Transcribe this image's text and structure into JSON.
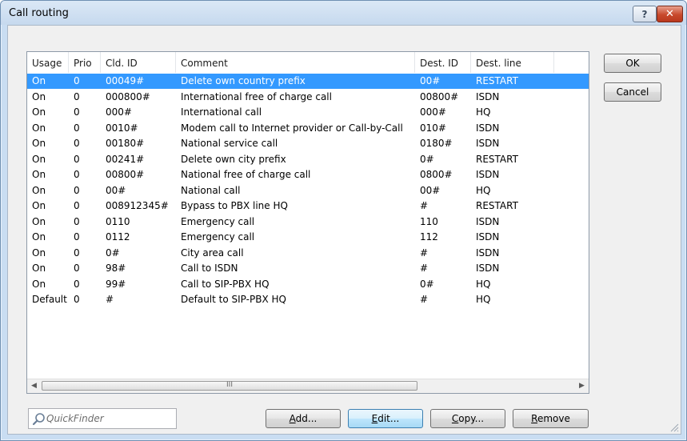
{
  "window": {
    "title": "Call routing"
  },
  "title_buttons": {
    "help": "?",
    "close": "✕"
  },
  "table": {
    "columns": [
      "Usage",
      "Prio",
      "Cld. ID",
      "Comment",
      "Dest. ID",
      "Dest. line"
    ],
    "rows": [
      [
        "On",
        "0",
        "00049#",
        "Delete own country prefix",
        "00#",
        "RESTART"
      ],
      [
        "On",
        "0",
        "000800#",
        "International free of charge call",
        "00800#",
        "ISDN"
      ],
      [
        "On",
        "0",
        "000#",
        "International call",
        "000#",
        "HQ"
      ],
      [
        "On",
        "0",
        "0010#",
        "Modem call to Internet provider or Call-by-Call",
        "010#",
        "ISDN"
      ],
      [
        "On",
        "0",
        "00180#",
        "National service call",
        "0180#",
        "ISDN"
      ],
      [
        "On",
        "0",
        "00241#",
        "Delete own city prefix",
        "0#",
        "RESTART"
      ],
      [
        "On",
        "0",
        "00800#",
        "National free of charge call",
        "0800#",
        "ISDN"
      ],
      [
        "On",
        "0",
        "00#",
        "National call",
        "00#",
        "HQ"
      ],
      [
        "On",
        "0",
        "008912345#",
        "Bypass to PBX line HQ",
        "#",
        "RESTART"
      ],
      [
        "On",
        "0",
        "0110",
        "Emergency call",
        "110",
        "ISDN"
      ],
      [
        "On",
        "0",
        "0112",
        "Emergency call",
        "112",
        "ISDN"
      ],
      [
        "On",
        "0",
        "0#",
        "City area call",
        "#",
        "ISDN"
      ],
      [
        "On",
        "0",
        "98#",
        "Call to ISDN",
        "#",
        "ISDN"
      ],
      [
        "On",
        "0",
        "99#",
        "Call to SIP-PBX HQ",
        "0#",
        "HQ"
      ],
      [
        "Default",
        "0",
        "#",
        "Default to SIP-PBX HQ",
        "#",
        "HQ"
      ]
    ],
    "selected_row": 0,
    "scroll_thumb_glyph": "III"
  },
  "buttons": {
    "ok": "OK",
    "cancel": "Cancel",
    "add": {
      "mnemonic": "A",
      "rest": "dd..."
    },
    "edit": {
      "mnemonic": "E",
      "rest": "dit..."
    },
    "copy": {
      "mnemonic": "C",
      "rest": "opy..."
    },
    "remove": {
      "mnemonic": "R",
      "rest": "emove"
    }
  },
  "quickfinder": {
    "placeholder": "QuickFinder"
  },
  "icons": {
    "help": "help-icon",
    "close": "close-icon",
    "quickfinder": "magnifier-icon",
    "scroll_left": "scroll-left-icon",
    "scroll_right": "scroll-right-icon",
    "resize": "resize-grip-icon"
  },
  "colors": {
    "selection": "#3399ff",
    "title_bar": "#c9ddf2",
    "close_button": "#c8492c"
  }
}
